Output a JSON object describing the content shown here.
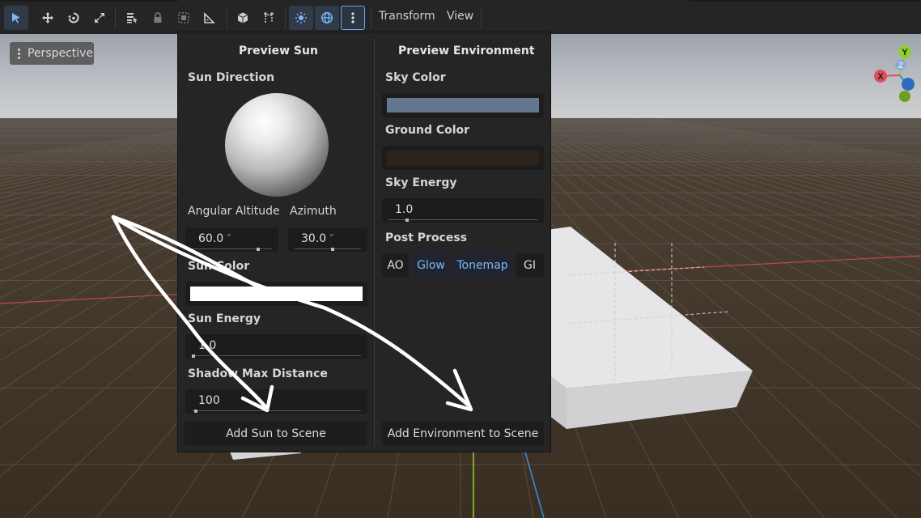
{
  "toolbar": {
    "tools": [
      {
        "name": "select-tool-icon",
        "active": true
      },
      {
        "name": "move-tool-icon"
      },
      {
        "name": "rotate-tool-icon"
      },
      {
        "name": "scale-tool-icon"
      },
      {
        "name": "list-select-icon"
      },
      {
        "name": "lock-icon"
      },
      {
        "name": "group-icon"
      },
      {
        "name": "ruler-icon"
      },
      {
        "name": "local-space-icon"
      },
      {
        "name": "snap-icon"
      },
      {
        "name": "preview-sun-toggle-icon",
        "active": true
      },
      {
        "name": "preview-environment-toggle-icon",
        "active": true
      },
      {
        "name": "more-options-icon",
        "outlined": true
      }
    ],
    "menu_transform": "Transform",
    "menu_view": "View"
  },
  "viewport": {
    "perspective_label": "Perspective"
  },
  "gizmo": {
    "y": "Y",
    "x": "X",
    "z": "Z"
  },
  "popup": {
    "sun": {
      "title": "Preview Sun",
      "direction_label": "Sun Direction",
      "altitude_label": "Angular Altitude",
      "azimuth_label": "Azimuth",
      "altitude_value": "60.0",
      "azimuth_value": "30.0",
      "degree_unit": "°",
      "color_label": "Sun Color",
      "color": "#ffffff",
      "energy_label": "Sun Energy",
      "energy_value": "1.0",
      "shadow_label": "Shadow Max Distance",
      "shadow_value": "100",
      "add_button": "Add Sun to Scene"
    },
    "environment": {
      "title": "Preview Environment",
      "sky_color_label": "Sky Color",
      "sky_color": "#647690",
      "ground_color_label": "Ground Color",
      "ground_color": "#2c241c",
      "sky_energy_label": "Sky Energy",
      "sky_energy_value": "1.0",
      "post_process_label": "Post Process",
      "post_buttons": [
        {
          "label": "AO",
          "on": false
        },
        {
          "label": "Glow",
          "on": true
        },
        {
          "label": "Tonemap",
          "on": true
        },
        {
          "label": "GI",
          "on": false
        }
      ],
      "add_button": "Add Environment to Scene"
    }
  },
  "colors": {
    "accent": "#6aa8ea",
    "toggle_on_text": "#7db9f5",
    "panel_bg": "#252525"
  }
}
